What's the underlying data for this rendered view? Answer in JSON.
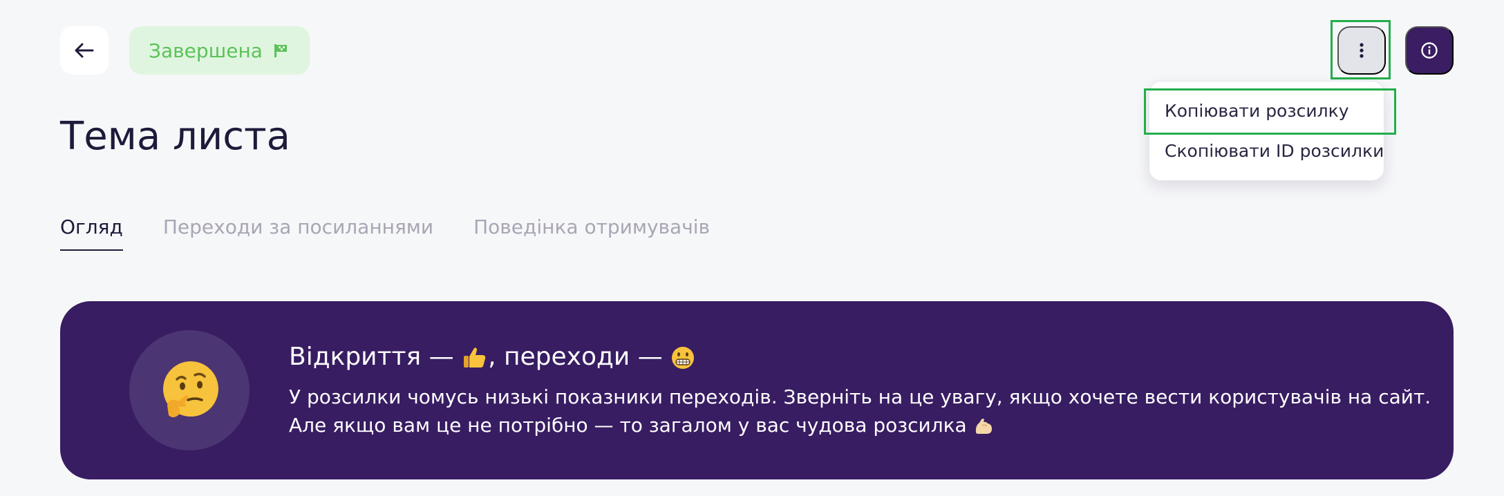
{
  "header": {
    "back_icon": "arrow-left-icon",
    "status": {
      "label": "Завершена",
      "icon": "flag-icon",
      "color": "#5cc25a",
      "background": "#e0f5df"
    },
    "menu_icon": "more-vertical-icon",
    "info_icon": "info-icon"
  },
  "dropdown": {
    "items": [
      {
        "label": "Копіювати розсилку"
      },
      {
        "label": "Скопіювати ID розсилки"
      }
    ]
  },
  "page": {
    "title": "Тема листа"
  },
  "tabs": [
    {
      "label": "Огляд",
      "active": true
    },
    {
      "label": "Переходи за посиланнями",
      "active": false
    },
    {
      "label": "Поведінка отримувачів",
      "active": false
    }
  ],
  "banner": {
    "avatar_icon": "thinking-face-icon",
    "heading_part1": "Відкриття — ",
    "heading_part2": ", переходи — ",
    "heading_icons": [
      "thumbs-up-icon",
      "grimacing-face-icon"
    ],
    "line1": "У розсилки чомусь низькі показники переходів. Зверніть на це увагу, якщо хочете вести користувачів на сайт.",
    "line2": "Але якщо вам це не потрібно — то загалом у вас чудова розсилка ",
    "line2_icon": "flexed-biceps-icon",
    "background": "#381d62"
  },
  "colors": {
    "accent": "#3a1d62",
    "highlight": "#22ad4a",
    "page_bg": "#f6f7f9"
  }
}
